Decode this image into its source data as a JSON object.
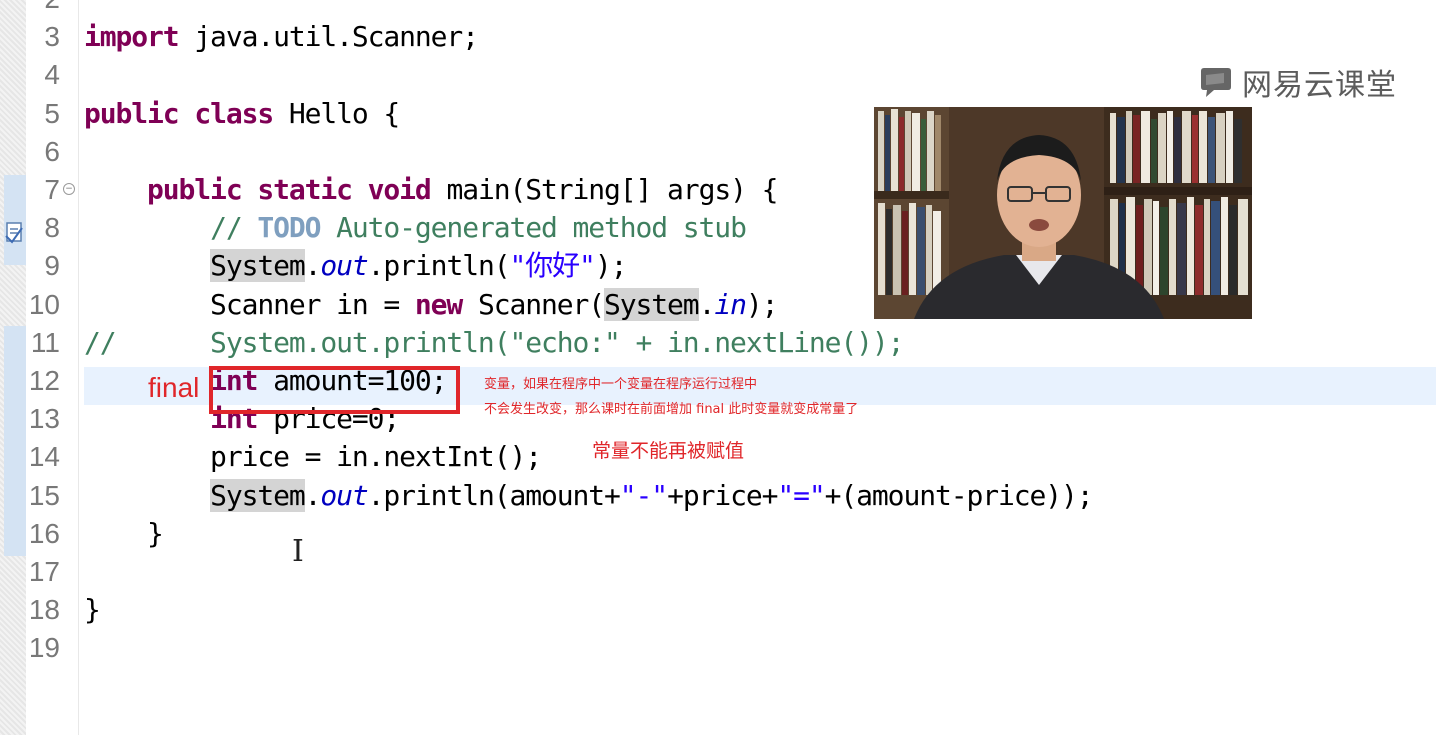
{
  "editor": {
    "lines": [
      {
        "num": "2",
        "tokens": []
      },
      {
        "num": "3",
        "tokens": [
          {
            "t": "import",
            "c": "kw"
          },
          {
            "t": " java.util.Scanner;"
          }
        ]
      },
      {
        "num": "4",
        "tokens": []
      },
      {
        "num": "5",
        "tokens": [
          {
            "t": "public",
            "c": "kw"
          },
          {
            "t": " "
          },
          {
            "t": "class",
            "c": "kw"
          },
          {
            "t": " Hello {"
          }
        ]
      },
      {
        "num": "6",
        "tokens": []
      },
      {
        "num": "7",
        "fold": true,
        "tokens": [
          {
            "t": "    "
          },
          {
            "t": "public",
            "c": "kw"
          },
          {
            "t": " "
          },
          {
            "t": "static",
            "c": "kw"
          },
          {
            "t": " "
          },
          {
            "t": "void",
            "c": "kw"
          },
          {
            "t": " main(String[] args) {"
          }
        ]
      },
      {
        "num": "8",
        "tokens": [
          {
            "t": "        "
          },
          {
            "t": "// ",
            "c": "cmt"
          },
          {
            "t": "TODO",
            "c": "todo"
          },
          {
            "t": " Auto-generated method stub",
            "c": "cmt"
          }
        ]
      },
      {
        "num": "9",
        "tokens": [
          {
            "t": "        "
          },
          {
            "t": "System",
            "c": "occ"
          },
          {
            "t": "."
          },
          {
            "t": "out",
            "c": "fld"
          },
          {
            "t": ".println("
          },
          {
            "t": "\"你好\"",
            "c": "str"
          },
          {
            "t": ");"
          }
        ]
      },
      {
        "num": "10",
        "tokens": [
          {
            "t": "        Scanner in = "
          },
          {
            "t": "new",
            "c": "kw"
          },
          {
            "t": " Scanner("
          },
          {
            "t": "System",
            "c": "occ"
          },
          {
            "t": "."
          },
          {
            "t": "in",
            "c": "fld"
          },
          {
            "t": ");"
          }
        ]
      },
      {
        "num": "11",
        "tokens": [
          {
            "t": "//      System.out.println(\"echo:\" + in.nextLine());",
            "c": "cmt"
          }
        ]
      },
      {
        "num": "12",
        "tokens": [
          {
            "t": "        "
          },
          {
            "t": "int",
            "c": "kw"
          },
          {
            "t": " amount=100;"
          }
        ]
      },
      {
        "num": "13",
        "tokens": [
          {
            "t": "        "
          },
          {
            "t": "int",
            "c": "kw"
          },
          {
            "t": " price=0;"
          }
        ]
      },
      {
        "num": "14",
        "tokens": [
          {
            "t": "        price = in.nextInt();"
          }
        ]
      },
      {
        "num": "15",
        "tokens": [
          {
            "t": "        "
          },
          {
            "t": "System",
            "c": "occ"
          },
          {
            "t": "."
          },
          {
            "t": "out",
            "c": "fld"
          },
          {
            "t": ".println(amount+"
          },
          {
            "t": "\"-\"",
            "c": "str"
          },
          {
            "t": "+price+"
          },
          {
            "t": "\"=\"",
            "c": "str"
          },
          {
            "t": "+(amount-price));"
          }
        ]
      },
      {
        "num": "16",
        "tokens": [
          {
            "t": "    }"
          }
        ]
      },
      {
        "num": "17",
        "tokens": []
      },
      {
        "num": "18",
        "tokens": [
          {
            "t": "}"
          }
        ]
      },
      {
        "num": "19",
        "tokens": []
      }
    ]
  },
  "annotations": {
    "final_label": "final",
    "note_line1": "变量，如果在程序中一个变量在程序运行过程中",
    "note_line2": "不会发生改变，那么课时在前面增加 final   此时变量就变成常量了",
    "note_const": "常量不能再被赋值"
  },
  "logo": {
    "text": "网易云课堂",
    "icon": "speech-bubble-icon"
  },
  "colors": {
    "annotation_red": "#e0262a",
    "keyword": "#7f0055",
    "string": "#2a00ff",
    "comment": "#3f7f5f",
    "field": "#0000c0"
  }
}
